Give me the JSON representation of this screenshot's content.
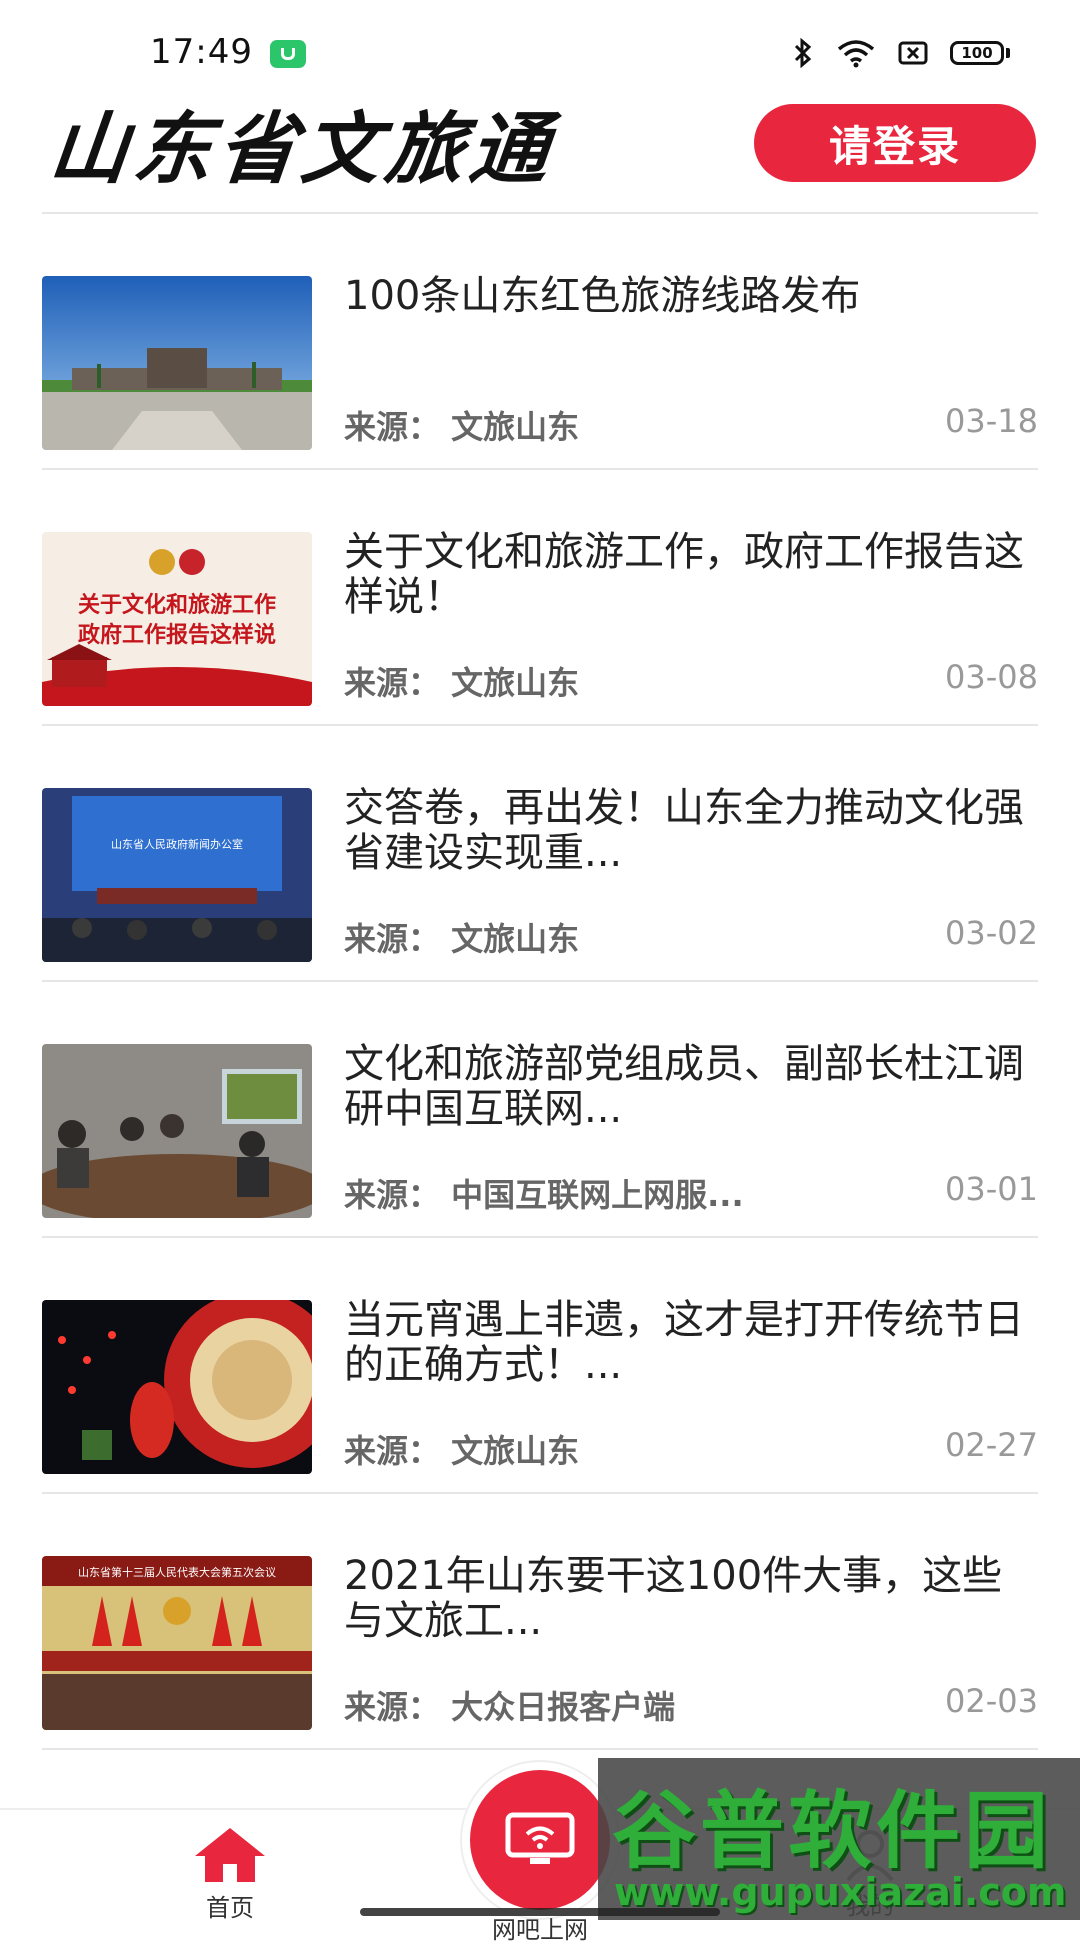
{
  "status_bar": {
    "time": "17:49",
    "battery": "100",
    "icons": [
      "bluetooth-icon",
      "wifi-icon",
      "sim-off-icon",
      "battery-icon"
    ]
  },
  "header": {
    "logo_text": "山东省文旅通",
    "login_label": "请登录"
  },
  "news": [
    {
      "title": "100条山东红色旅游线路发布",
      "source": "来源：  文旅山东",
      "date": "03-18"
    },
    {
      "title": "关于文化和旅游工作，政府工作报告这样说！",
      "source": "来源：  文旅山东",
      "date": "03-08"
    },
    {
      "title": "交答卷，再出发！山东全力推动文化强省建设实现重...",
      "source": "来源：  文旅山东",
      "date": "03-02"
    },
    {
      "title": "文化和旅游部党组成员、副部长杜江调研中国互联网...",
      "source": "来源：  中国互联网上网服...",
      "date": "03-01"
    },
    {
      "title": "当元宵遇上非遗，这才是打开传统节日的正确方式！...",
      "source": "来源：  文旅山东",
      "date": "02-27"
    },
    {
      "title": "2021年山东要干这100件大事，这些与文旅工...",
      "source": "来源：  大众日报客户端",
      "date": "02-03"
    }
  ],
  "thumb_text": {
    "t2_line1": "关于文化和旅游工作",
    "t2_line2": "政府工作报告这样说",
    "t3_banner": "山东省人民政府新闻办公室",
    "t6_banner": "山东省第十三届人民代表大会第五次会议"
  },
  "bottom_nav": {
    "home_label": "首页",
    "center_label": "网吧上网",
    "me_label": "我的"
  },
  "watermark": {
    "big": "谷普软件园",
    "small": "www.gupuxiazai.com"
  },
  "colors": {
    "accent": "#e8273f",
    "watermark_green": "#2fae3a"
  }
}
